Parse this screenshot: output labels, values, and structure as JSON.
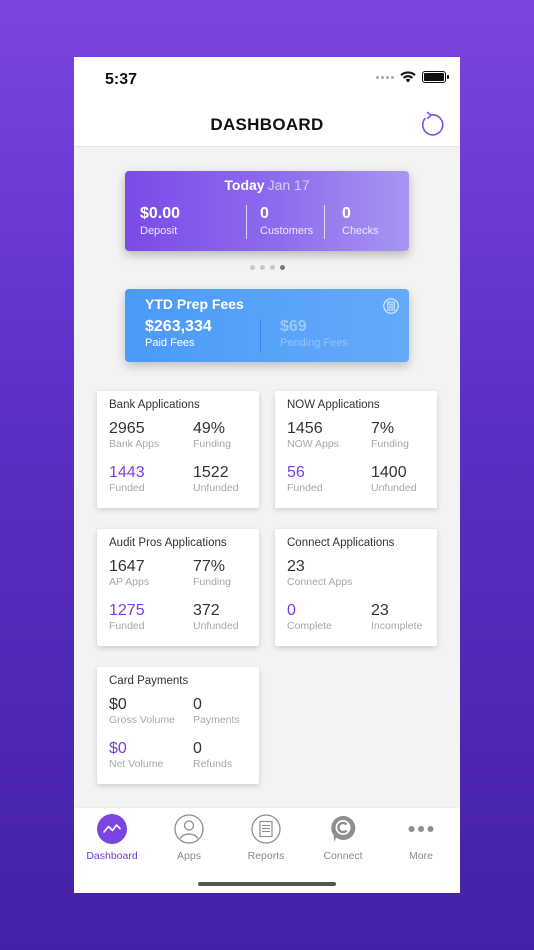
{
  "status_bar": {
    "time": "5:37"
  },
  "header": {
    "title": "DASHBOARD",
    "refresh_icon": "refresh-icon"
  },
  "today_card": {
    "label": "Today",
    "date": "Jan 17",
    "stats": [
      {
        "value": "$0.00",
        "label": "Deposit"
      },
      {
        "value": "0",
        "label": "Customers"
      },
      {
        "value": "0",
        "label": "Checks"
      }
    ]
  },
  "pager": {
    "pages": 4,
    "active_index": 3
  },
  "ytd_card": {
    "title": "YTD Prep Fees",
    "icon": "receipt-icon",
    "paid": {
      "value": "$263,334",
      "label": "Paid Fees"
    },
    "pending": {
      "value": "$69",
      "label": "Pending Fees"
    }
  },
  "cards": {
    "bank": {
      "title": "Bank Applications",
      "cells": [
        {
          "value": "2965",
          "label": "Bank Apps"
        },
        {
          "value": "49%",
          "label": "Funding"
        },
        {
          "value": "1443",
          "label": "Funded"
        },
        {
          "value": "1522",
          "label": "Unfunded"
        }
      ]
    },
    "now": {
      "title": "NOW Applications",
      "cells": [
        {
          "value": "1456",
          "label": "NOW Apps"
        },
        {
          "value": "7%",
          "label": "Funding"
        },
        {
          "value": "56",
          "label": "Funded"
        },
        {
          "value": "1400",
          "label": "Unfunded"
        }
      ]
    },
    "audit": {
      "title": "Audit Pros Applications",
      "cells": [
        {
          "value": "1647",
          "label": "AP Apps"
        },
        {
          "value": "77%",
          "label": "Funding"
        },
        {
          "value": "1275",
          "label": "Funded"
        },
        {
          "value": "372",
          "label": "Unfunded"
        }
      ]
    },
    "connect": {
      "title": "Connect Applications",
      "cells": [
        {
          "value": "23",
          "label": "Connect Apps"
        },
        {
          "value": "0",
          "label": "Complete"
        },
        {
          "value": "23",
          "label": "Incomplete"
        }
      ]
    },
    "card_payments": {
      "title": "Card Payments",
      "cells": [
        {
          "value": "$0",
          "label": "Gross Volume"
        },
        {
          "value": "0",
          "label": "Payments"
        },
        {
          "value": "$0",
          "label": "Net Volume"
        },
        {
          "value": "0",
          "label": "Refunds"
        }
      ]
    }
  },
  "tab_bar": {
    "tabs": [
      {
        "label": "Dashboard",
        "icon": "dashboard-icon",
        "active": true
      },
      {
        "label": "Apps",
        "icon": "user-icon",
        "active": false
      },
      {
        "label": "Reports",
        "icon": "reports-icon",
        "active": false
      },
      {
        "label": "Connect",
        "icon": "connect-icon",
        "active": false
      },
      {
        "label": "More",
        "icon": "more-icon",
        "active": false
      }
    ]
  },
  "colors": {
    "accent_purple": "#7c3ee0",
    "today_gradient_start": "#7a4be8",
    "ytd_blue": "#4b9af7",
    "background_gradient": "#6a38d4"
  }
}
